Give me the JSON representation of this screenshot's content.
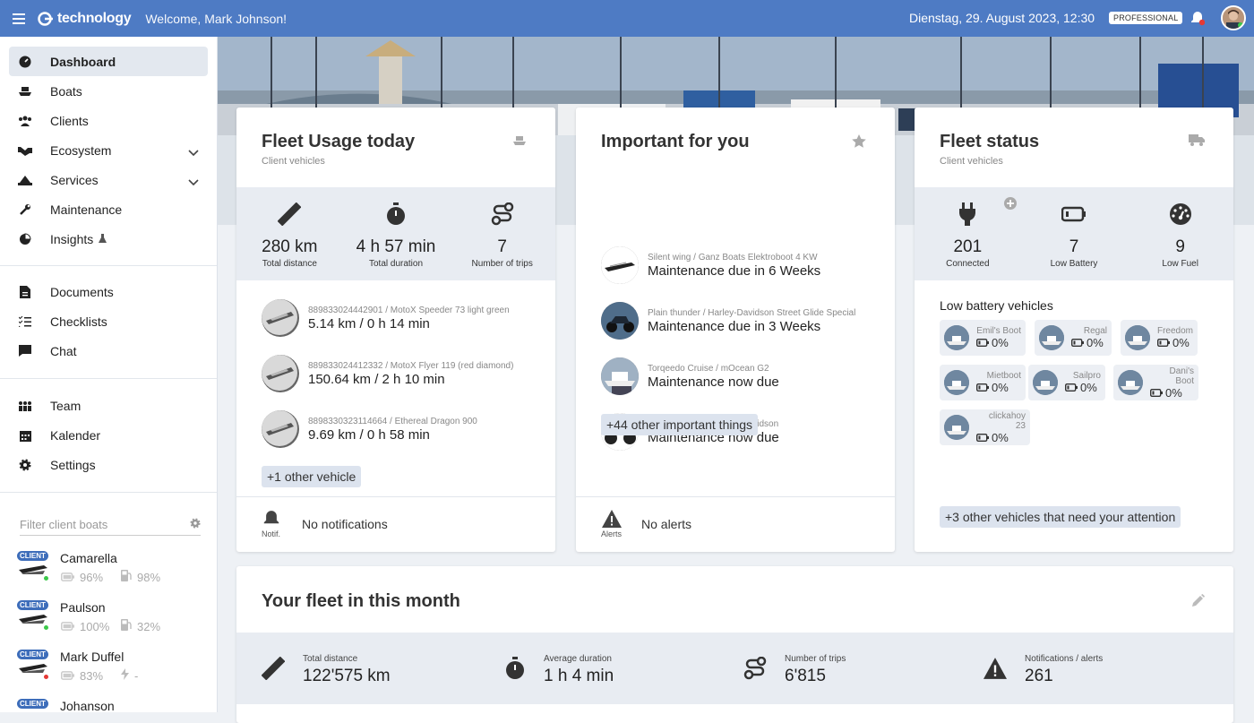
{
  "header": {
    "logo_text": "technology",
    "welcome": "Welcome, Mark Johnson!",
    "datetime": "Dienstag, 29. August 2023, 12:30",
    "plan_badge": "PROFESSIONAL"
  },
  "sidebar": {
    "main_items": [
      {
        "label": "Dashboard",
        "icon": "dashboard-icon",
        "active": true
      },
      {
        "label": "Boats",
        "icon": "boat-icon"
      },
      {
        "label": "Clients",
        "icon": "users-icon"
      },
      {
        "label": "Ecosystem",
        "icon": "handshake-icon",
        "expandable": true
      },
      {
        "label": "Services",
        "icon": "services-icon",
        "expandable": true
      },
      {
        "label": "Maintenance",
        "icon": "wrench-icon"
      },
      {
        "label": "Insights",
        "icon": "pie-chart-icon",
        "beta": true
      }
    ],
    "doc_items": [
      {
        "label": "Documents",
        "icon": "document-icon"
      },
      {
        "label": "Checklists",
        "icon": "checklist-icon"
      },
      {
        "label": "Chat",
        "icon": "chat-icon"
      }
    ],
    "org_items": [
      {
        "label": "Team",
        "icon": "team-icon"
      },
      {
        "label": "Kalender",
        "icon": "calendar-icon"
      },
      {
        "label": "Settings",
        "icon": "gear-icon"
      }
    ],
    "filter_placeholder": "Filter client boats",
    "client_badge": "CLIENT",
    "boats": [
      {
        "name": "Camarella",
        "battery": "96%",
        "second": "98%",
        "second_icon": "fuel-icon",
        "status_color": "#3cc94a"
      },
      {
        "name": "Paulson",
        "battery": "100%",
        "second": "32%",
        "second_icon": "fuel-icon",
        "status_color": "#3cc94a"
      },
      {
        "name": "Mark Duffel",
        "battery": "83%",
        "second": "-",
        "second_icon": "bolt-icon",
        "status_color": "#e53935"
      },
      {
        "name": "Johanson",
        "battery": "",
        "second": "",
        "second_icon": "",
        "status_color": "#3cc94a"
      }
    ]
  },
  "fleet_usage": {
    "title": "Fleet Usage today",
    "subtitle": "Client vehicles",
    "stats": [
      {
        "value": "280 km",
        "label": "Total distance",
        "icon": "ruler-icon"
      },
      {
        "value": "4 h 57 min",
        "label": "Total duration",
        "icon": "stopwatch-icon"
      },
      {
        "value": "7",
        "label": "Number of trips",
        "icon": "route-icon"
      }
    ],
    "vehicles": [
      {
        "sub": "889833024442901 / MotoX Speeder 73 light green",
        "value": "5.14 km / 0 h 14 min"
      },
      {
        "sub": "889833024412332 / MotoX Flyer 119 (red diamond)",
        "value": "150.64 km / 2 h 10 min"
      },
      {
        "sub": "8898330323114664 / Ethereal Dragon 900",
        "value": "9.69 km / 0 h 58 min"
      }
    ],
    "more": "+1 other vehicle",
    "footer_icon_label": "Notif.",
    "footer_text": "No notifications"
  },
  "important": {
    "title": "Important for you",
    "items": [
      {
        "sub": "Silent wing / Ganz Boats Elektroboot 4 KW",
        "value": "Maintenance due in 6 Weeks"
      },
      {
        "sub": "Plain thunder / Harley-Davidson Street Glide Special",
        "value": "Maintenance due in 3 Weeks"
      },
      {
        "sub": "Torqeedo Cruise / mOcean G2",
        "value": "Maintenance now due"
      },
      {
        "sub": "LiveWire 2020 / Harley-Davidson",
        "value": "Maintenance now due"
      }
    ],
    "more": "+44 other important things",
    "footer_icon_label": "Alerts",
    "footer_text": "No alerts"
  },
  "fleet_status": {
    "title": "Fleet status",
    "subtitle": "Client vehicles",
    "stats": [
      {
        "value": "201",
        "label": "Connected",
        "icon": "plug-icon"
      },
      {
        "value": "7",
        "label": "Low Battery",
        "icon": "battery-icon"
      },
      {
        "value": "9",
        "label": "Low Fuel",
        "icon": "gauge-icon"
      }
    ],
    "low_battery_title": "Low battery vehicles",
    "low_battery": [
      {
        "name": "Emil's Boot",
        "pct": "0%"
      },
      {
        "name": "Regal",
        "pct": "0%"
      },
      {
        "name": "Freedom",
        "pct": "0%"
      },
      {
        "name": "Mietboot",
        "pct": "0%"
      },
      {
        "name": "Sailpro",
        "pct": "0%"
      },
      {
        "name": "Dani's Boot",
        "pct": "0%"
      },
      {
        "name": "clickahoy 23",
        "pct": "0%"
      }
    ],
    "more": "+3 other vehicles that need your attention"
  },
  "month": {
    "title": "Your fleet in this month",
    "stats": [
      {
        "label": "Total distance",
        "value": "122'575 km",
        "icon": "ruler-icon"
      },
      {
        "label": "Average duration",
        "value": "1 h 4 min",
        "icon": "stopwatch-icon"
      },
      {
        "label": "Number of trips",
        "value": "6'815",
        "icon": "route-icon"
      },
      {
        "label": "Notifications / alerts",
        "value": "261",
        "icon": "warning-icon"
      }
    ]
  },
  "colors": {
    "header": "#4e7bc4",
    "band": "#e8ecf2",
    "chip": "#dce3ee",
    "client_badge": "#3d6dba"
  }
}
